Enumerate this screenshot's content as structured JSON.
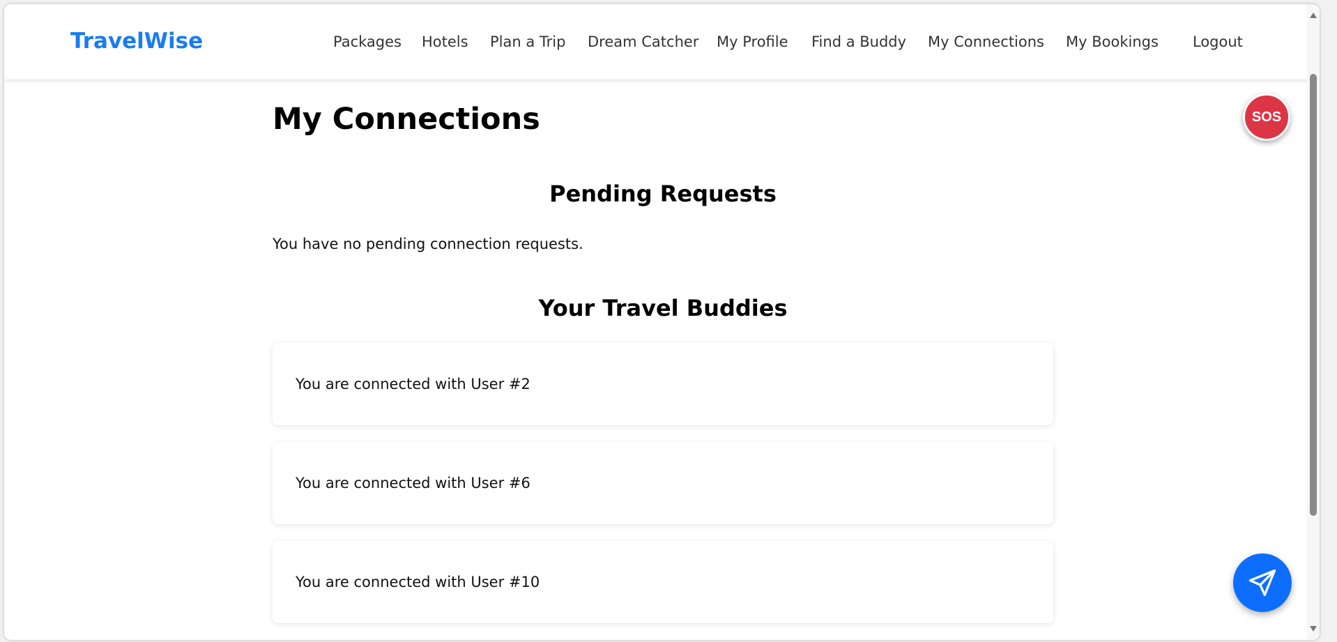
{
  "navbar": {
    "brand": "TravelWise",
    "links": [
      "Packages",
      "Hotels",
      "Plan a Trip",
      "Dream Catcher",
      "My Profile",
      "Find a Buddy",
      "My Connections",
      "My Bookings",
      "Logout"
    ]
  },
  "page": {
    "title": "My Connections"
  },
  "pending": {
    "heading": "Pending Requests",
    "empty_message": "You have no pending connection requests."
  },
  "buddies": {
    "heading": "Your Travel Buddies",
    "items": [
      "You are connected with User #2",
      "You are connected with User #6",
      "You are connected with User #10"
    ]
  },
  "floating": {
    "sos_label": "SOS",
    "chat_icon": "send-icon"
  },
  "colors": {
    "brand": "#1a7cf0",
    "sos": "#dc3545",
    "chat": "#0d6efd"
  }
}
